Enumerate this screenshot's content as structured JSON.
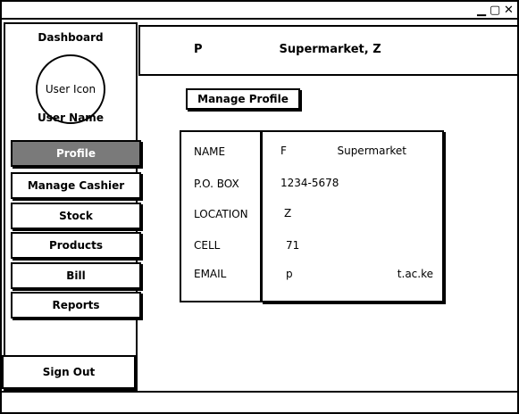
{
  "window": {
    "controls": {
      "minimize": "▁",
      "maximize": "▢",
      "close": "✕"
    }
  },
  "sidebar": {
    "title": "Dashboard",
    "avatar_label": "User Icon",
    "user_name": "User Name",
    "items": [
      {
        "label": "Profile",
        "active": true
      },
      {
        "label": "Manage Cashier",
        "active": false
      },
      {
        "label": "Stock",
        "active": false
      },
      {
        "label": "Products",
        "active": false
      },
      {
        "label": "Bill",
        "active": false
      },
      {
        "label": "Reports",
        "active": false
      }
    ],
    "sign_out": "Sign Out"
  },
  "header": {
    "title": "P                   Supermarket, Z"
  },
  "main": {
    "manage_profile_button": "Manage Profile",
    "profile": {
      "labels": {
        "name": "NAME",
        "pobox": "P.O. BOX",
        "location": "LOCATION",
        "cell": "CELL",
        "email": "EMAIL"
      },
      "values": {
        "name_start": "F",
        "name_end": "Supermarket",
        "pobox": "1234-5678",
        "location": "Z",
        "cell": "71",
        "email_start": "p",
        "email_end": "t.ac.ke"
      }
    }
  },
  "colors": {
    "active_nav_bg": "#7a7a7a",
    "border": "#000000"
  }
}
